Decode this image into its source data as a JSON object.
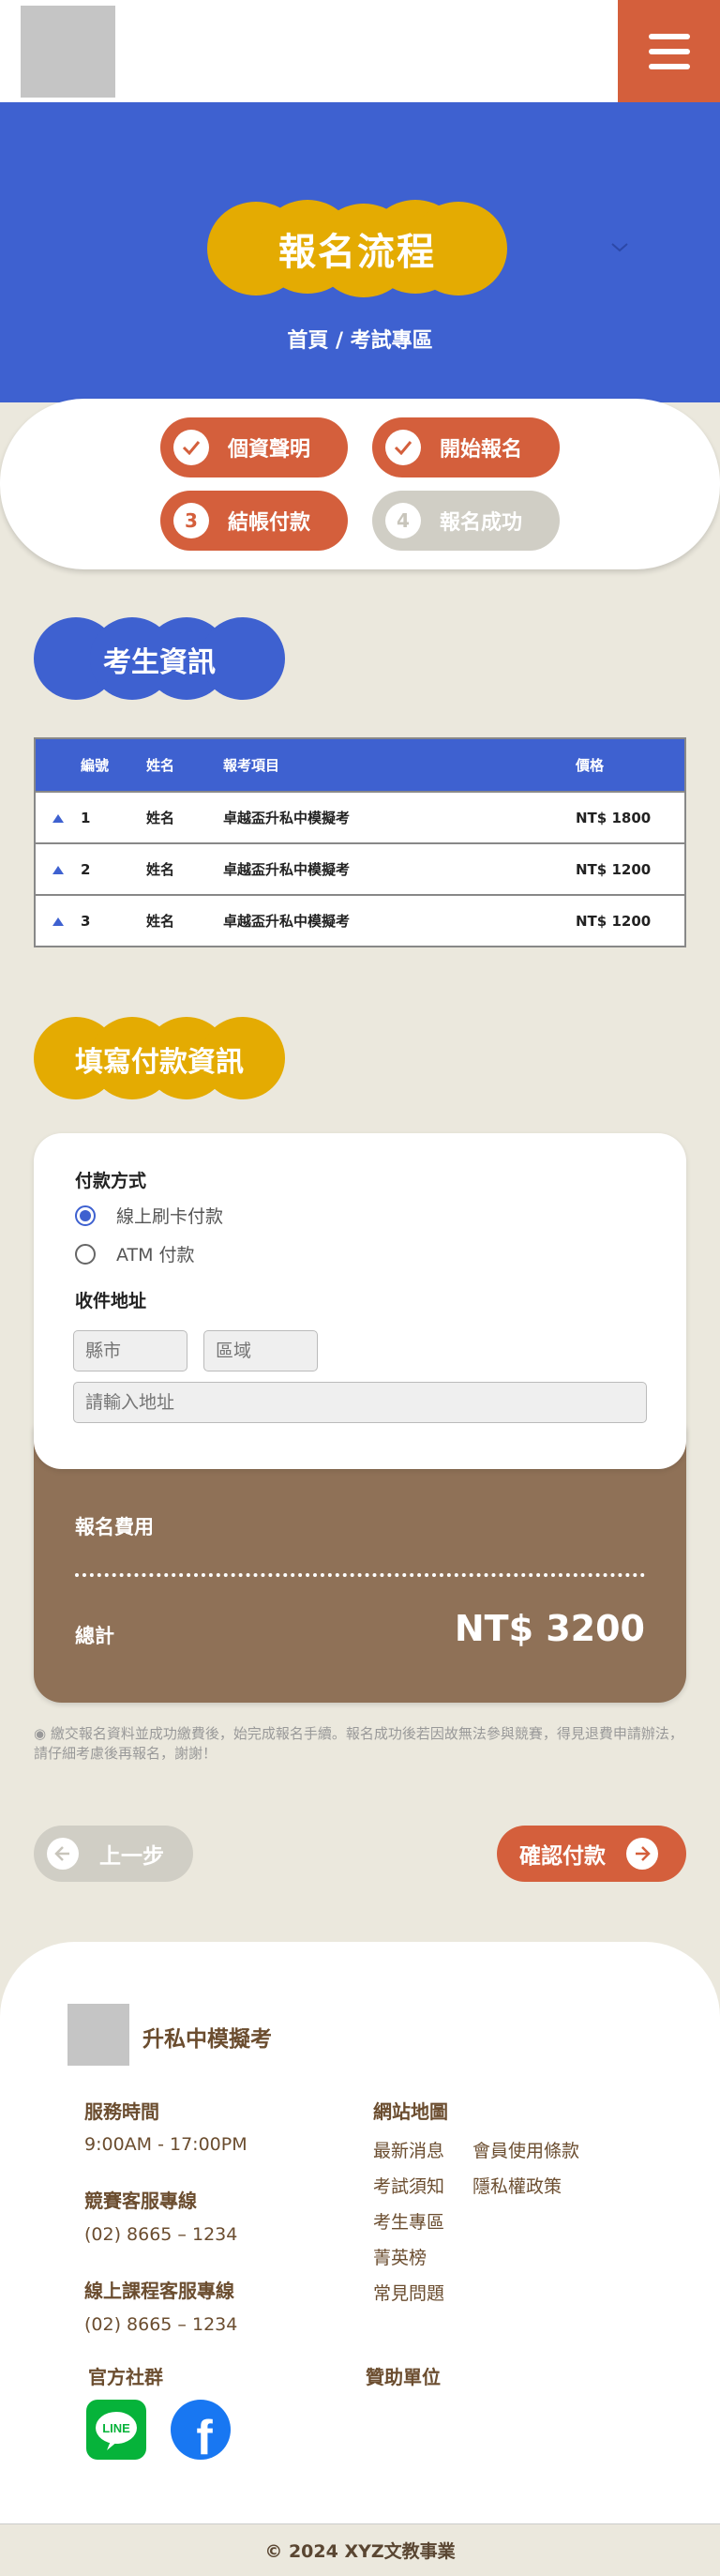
{
  "header": {
    "menu_icon": "hamburger-menu-icon"
  },
  "hero": {
    "title": "報名流程",
    "breadcrumb": "首頁 / 考試專區"
  },
  "steps": [
    {
      "label": "個資聲明",
      "marker": "✓",
      "status": "done"
    },
    {
      "label": "開始報名",
      "marker": "✓",
      "status": "done"
    },
    {
      "label": "結帳付款",
      "marker": "3",
      "status": "current"
    },
    {
      "label": "報名成功",
      "marker": "4",
      "status": "pending"
    }
  ],
  "candidate": {
    "title": "考生資訊",
    "columns": [
      "編號",
      "姓名",
      "報考項目",
      "價格"
    ],
    "rows": [
      {
        "no": "1",
        "name": "姓名",
        "item": "卓越盃升私中模擬考",
        "price": "NT$ 1800"
      },
      {
        "no": "2",
        "name": "姓名",
        "item": "卓越盃升私中模擬考",
        "price": "NT$ 1200"
      },
      {
        "no": "3",
        "name": "姓名",
        "item": "卓越盃升私中模擬考",
        "price": "NT$ 1200"
      }
    ]
  },
  "payment": {
    "title": "填寫付款資訊",
    "method_label": "付款方式",
    "options": [
      {
        "label": "線上刷卡付款",
        "selected": true
      },
      {
        "label": "ATM 付款",
        "selected": false
      }
    ],
    "address_label": "收件地址",
    "city_placeholder": "縣市",
    "district_placeholder": "區域",
    "address_placeholder": "請輸入地址"
  },
  "fee": {
    "title": "報名費用",
    "total_label": "總計",
    "total_value": "NT$ 3200"
  },
  "notice": "◉ 繳交報名資料並成功繳費後，始完成報名手續。報名成功後若因故無法參與競賽，得見退費申請辦法，請仔細考慮後再報名，謝謝！",
  "nav": {
    "prev_label": "上一步",
    "next_label": "確認付款"
  },
  "footer": {
    "brand": "升私中模擬考",
    "hours_label": "服務時間",
    "hours_value": "9:00AM - 17:00PM",
    "contest_label": "競賽客服專線",
    "contest_phone": "(02) 8665 – 1234",
    "course_label": "線上課程客服專線",
    "course_phone": "(02) 8665 – 1234",
    "sitemap_label": "網站地圖",
    "sitemap": [
      "最新消息",
      "會員使用條款",
      "考試須知",
      "隱私權政策",
      "考生專區",
      "菁英榜",
      "常見問題"
    ],
    "social_label": "官方社群",
    "sponsor_label": "贊助單位",
    "line_text": "LINE",
    "facebook_glyph": "f"
  },
  "copyright": "© 2024 XYZ文教事業",
  "colors": {
    "primary_blue": "#3e61d0",
    "accent_orange": "#d45f3c",
    "gold": "#e4ab02",
    "brown": "#8f7157",
    "bg": "#ebe8dd"
  }
}
